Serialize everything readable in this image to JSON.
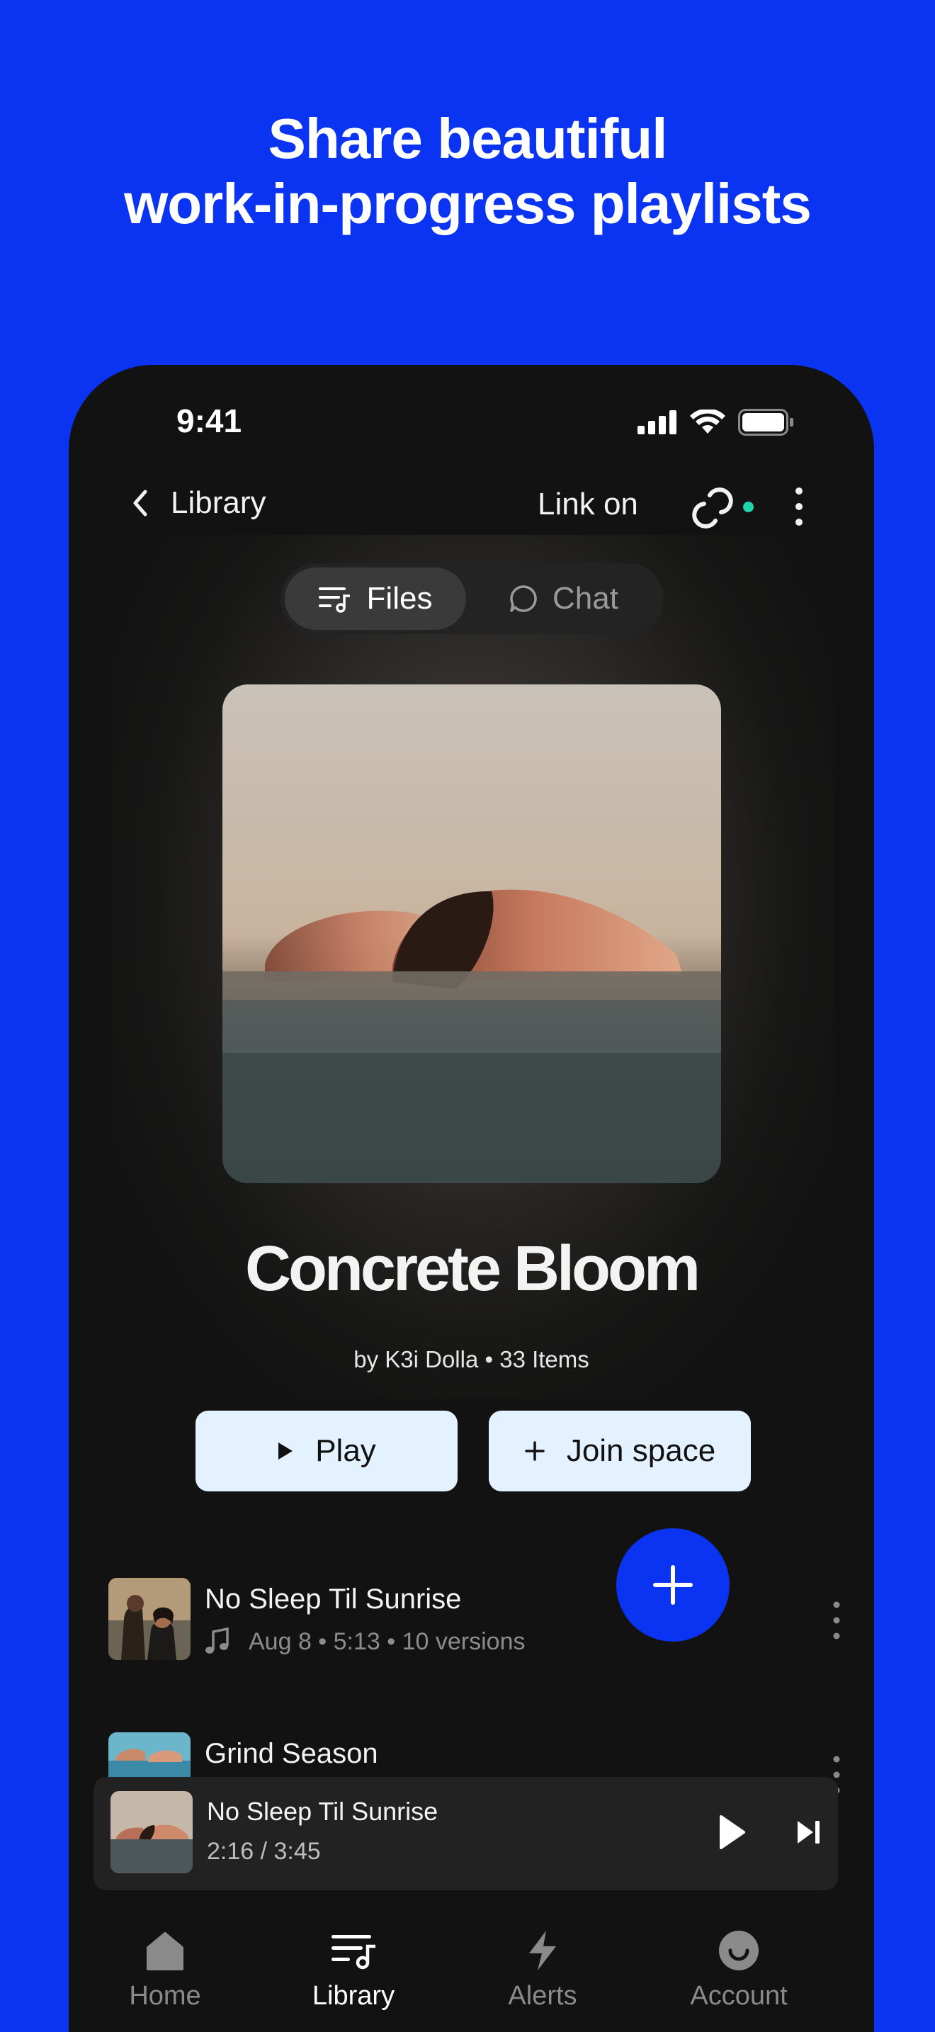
{
  "headline": {
    "line1": "Share beautiful",
    "line2": "work-in-progress playlists"
  },
  "status_bar": {
    "time": "9:41"
  },
  "nav": {
    "back_label": "Library",
    "link_status": "Link on",
    "link_dot_color": "#1ed4a8"
  },
  "segments": {
    "files_label": "Files",
    "chat_label": "Chat",
    "selected": "Files"
  },
  "playlist": {
    "title": "Concrete Bloom",
    "byline": "by K3i Dolla • 33 Items"
  },
  "actions": {
    "play_label": "Play",
    "join_label": "Join space"
  },
  "tracks": [
    {
      "name": "No Sleep Til Sunrise",
      "meta": "Aug 8 • 5:13 • 10 versions"
    },
    {
      "name": "Grind Season"
    }
  ],
  "mini_player": {
    "title": "No Sleep Til Sunrise",
    "time": "2:16 / 3:45"
  },
  "tabbar": [
    {
      "label": "Home",
      "icon": "home-icon"
    },
    {
      "label": "Library",
      "icon": "library-icon"
    },
    {
      "label": "Alerts",
      "icon": "bolt-icon"
    },
    {
      "label": "Account",
      "icon": "smiley-icon"
    }
  ],
  "active_tab": "Library",
  "colors": {
    "brand_blue": "#0a33f2",
    "button_bg": "#e4f1ff",
    "phone_bg": "#121212"
  }
}
